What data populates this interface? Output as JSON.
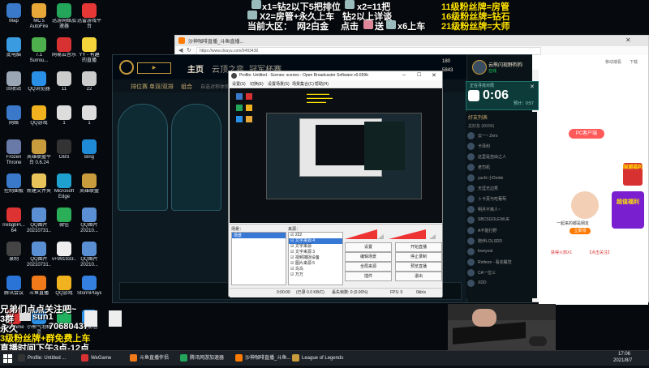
{
  "desktop_icons": [
    {
      "label": "Map",
      "color": "#3a79c9",
      "col": 0,
      "row": 0
    },
    {
      "label": "MC's AutoFire",
      "color": "#e8a838",
      "col": 1,
      "row": 0
    },
    {
      "label": "迅游网络加速器",
      "color": "#23a55a",
      "col": 2,
      "row": 0
    },
    {
      "label": "迅雷游戏平台",
      "color": "#e63737",
      "col": 3,
      "row": 0
    },
    {
      "label": "此电脑",
      "color": "#3a9be0",
      "col": 0,
      "row": 1
    },
    {
      "label": "7.1 Surrou...",
      "color": "#4db04d",
      "col": 1,
      "row": 1
    },
    {
      "label": "网易云音乐",
      "color": "#d83131",
      "col": 2,
      "row": 1
    },
    {
      "label": "YY - 有趣的直播",
      "color": "#f5d33a",
      "col": 3,
      "row": 1
    },
    {
      "label": "回收站",
      "color": "#9aa6b3",
      "col": 0,
      "row": 2
    },
    {
      "label": "QQ浏览器",
      "color": "#2a8fe6",
      "col": 1,
      "row": 2
    },
    {
      "label": "11",
      "color": "#cccccc",
      "col": 2,
      "row": 2
    },
    {
      "label": "22",
      "color": "#cccccc",
      "col": 3,
      "row": 2
    },
    {
      "label": "网络",
      "color": "#3a79c9",
      "col": 0,
      "row": 3
    },
    {
      "label": "QQ游戏",
      "color": "#f0b21e",
      "col": 1,
      "row": 3
    },
    {
      "label": "1",
      "color": "#dddddd",
      "col": 2,
      "row": 3
    },
    {
      "label": "1",
      "color": "#dddddd",
      "col": 3,
      "row": 3
    },
    {
      "label": "Frozen Throne",
      "color": "#6a7aa8",
      "col": 0,
      "row": 4
    },
    {
      "label": "英雄联盟平台 0.6.24",
      "color": "#c89b3c",
      "col": 1,
      "row": 4
    },
    {
      "label": "OBS",
      "color": "#333333",
      "col": 2,
      "row": 4
    },
    {
      "label": "Bing",
      "color": "#1f8ad6",
      "col": 3,
      "row": 4
    },
    {
      "label": "控制面板",
      "color": "#3a79c9",
      "col": 0,
      "row": 5
    },
    {
      "label": "新建文件夹",
      "color": "#e8c35a",
      "col": 1,
      "row": 5
    },
    {
      "label": "Microsoft Edge",
      "color": "#1fa1d0",
      "col": 2,
      "row": 5
    },
    {
      "label": "英雄联盟",
      "color": "#c89b3c",
      "col": 3,
      "row": 5
    },
    {
      "label": "rrebgbPi... 64",
      "color": "#d33",
      "col": 0,
      "row": 6
    },
    {
      "label": "QQ图片 20210731...",
      "color": "#5b8fd4",
      "col": 1,
      "row": 6
    },
    {
      "label": "微信",
      "color": "#2aae57",
      "col": 2,
      "row": 6
    },
    {
      "label": "QQ图片 20210...",
      "color": "#5b8fd4",
      "col": 3,
      "row": 6
    },
    {
      "label": "录制",
      "color": "#444",
      "col": 0,
      "row": 7
    },
    {
      "label": "QQ图片 20210731...",
      "color": "#5b8fd4",
      "col": 1,
      "row": 7
    },
    {
      "label": "v+991933...",
      "color": "#eee",
      "col": 2,
      "row": 7
    },
    {
      "label": "QQ图片 20210...",
      "color": "#5b8fd4",
      "col": 3,
      "row": 7
    },
    {
      "label": "腾讯会议",
      "color": "#2a74d8",
      "col": 0,
      "row": 8
    },
    {
      "label": "斗鱼直播",
      "color": "#f07a1a",
      "col": 1,
      "row": 8
    },
    {
      "label": "QQ游戏",
      "color": "#f0b21e",
      "col": 2,
      "row": 8
    },
    {
      "label": "StormPlayer",
      "color": "#3380e0",
      "col": 3,
      "row": 8
    },
    {
      "label": "WeGame",
      "color": "#d83131",
      "col": 0,
      "row": 9
    },
    {
      "label": "小熊气泡精灵",
      "color": "#2a8fe6",
      "col": 1,
      "row": 9
    },
    {
      "label": "QQ音乐",
      "color": "#21b25f",
      "col": 2,
      "row": 9
    },
    {
      "label": "QQ影音",
      "color": "#2a8fe6",
      "col": 3,
      "row": 9
    }
  ],
  "overlay": {
    "line1_a": "x1=钻2以下5把排位",
    "line1_b": "x2=11把",
    "line2_a": "X2=房管+永久上车",
    "line2_b": "钻2以上详谈",
    "line3_a": "当前大区：",
    "line3_b": "网2白金",
    "line3_c": "点击",
    "line3_d": "送",
    "line3_e": "x6上车",
    "r1": "11级粉丝牌=房管",
    "r2": "16级粉丝牌=钻石",
    "r3": "21级粉丝牌=大师",
    "bl1": "兄弟们点点关注吧~",
    "bl2": "3群",
    "bl3": "sun1",
    "bl4": "永久",
    "bl5": "70680437",
    "bl6": "3级粉丝牌+群免费上车",
    "bl7": "直播时间下午3点-12点"
  },
  "browser": {
    "tab_title": "沙神咖啡直播_斗鱼直播...",
    "url": "https://www.douyu.com/9493430",
    "buttons": [
      "移动端看",
      "下载"
    ],
    "pc_label": "PC客户端",
    "promo1": "国潮福利",
    "promo2": "超值福利",
    "promo_button": "立即领",
    "promo_caption": "一起来的都是朋友",
    "follow_text": "【点击关注】",
    "gift_text": "获得火箭X1"
  },
  "lol": {
    "nav": [
      "主页",
      "云顶之弈",
      "冠军杯赛"
    ],
    "sub_nav": [
      "排位赛 单双/双排",
      "组合",
      "自选对称体验"
    ],
    "queue_timer": "0:06",
    "queue_label": "正在寻找对局",
    "queue_sub": "预计：0:57",
    "player": "云熊闪现野狗狗",
    "status": "在线",
    "currency1": "180",
    "currency2": "5843",
    "friends_header": "好友列表",
    "friends_group": "总好友 (80/96)",
    "friends": [
      "云一~ Zero",
      "卡泽利",
      "这里是自由之人",
      "老司机",
      "yuchi 小Doinb",
      "天涯无边秀",
      "卜卡芙与吃葡萄",
      "明月不离人~",
      "SBCSGOLEWUE",
      "A不能打野",
      "陪伴LOLSDD",
      "loveyoul",
      "Rinfeon - 看完睡觉",
      "CA一位三",
      "XDD"
    ]
  },
  "obs": {
    "title": "Profile: Untitled - Scenes: scenes - Open Broadcaster Software v0.659b",
    "menu": [
      "设置(S)",
      "切换(E)",
      "设置场景(S)",
      "场景集合(C)",
      "帮助(H)"
    ],
    "scenes_header": "场景：",
    "sources_header": "来源：",
    "scenes": [
      "场景"
    ],
    "sources": [
      "222",
      "文字来源 4",
      "文字来源",
      "文字来源 3",
      "视频捕捉设备",
      "图片来源 5",
      "鸟鸟",
      "万万"
    ],
    "buttons": [
      "设置",
      "开始直播",
      "编辑场景",
      "停止录制",
      "全局来源",
      "预览直播",
      "插件",
      "退出"
    ],
    "status_time": "0:00:00",
    "status_stat": "(已录 0.0 KB/C)",
    "status_frames": "丢失帧数: 0 (0.00%)",
    "status_fps": "FPS: 0",
    "status_bitrate": "0kb/s"
  },
  "taskbar": {
    "items": [
      "Profile: Untitled ...",
      "WeGame",
      "斗鱼直播伴侣",
      "腾讯网游加速器",
      "沙神咖啡直播_斗鱼...",
      "League of Legends"
    ],
    "time": "17:06",
    "date": "2021/8/7"
  },
  "colors": {
    "accent_yellow": "#ffe400",
    "lol_gold": "#c89b3c",
    "douyu_orange": "#ff7a00"
  }
}
